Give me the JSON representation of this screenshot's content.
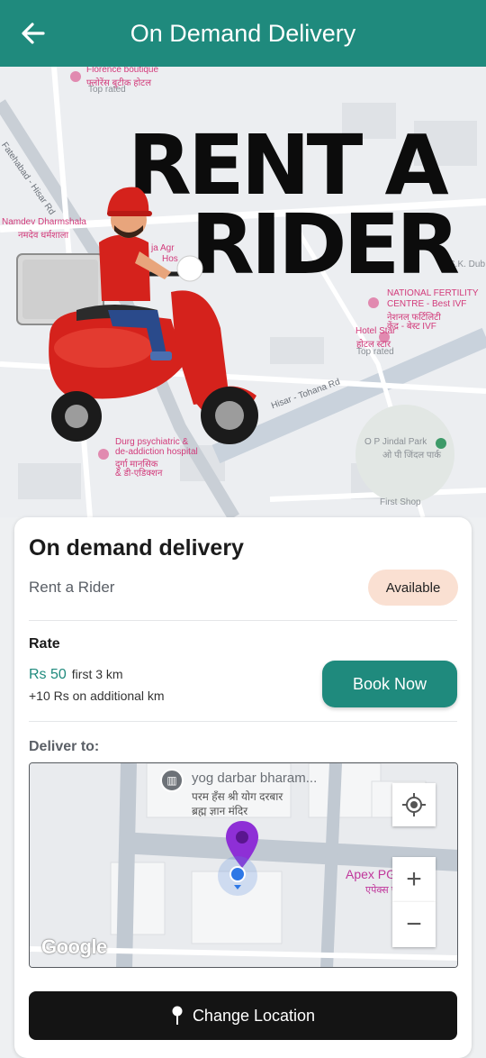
{
  "header": {
    "title": "On Demand Delivery",
    "back_icon": "back-arrow-icon"
  },
  "hero": {
    "title_line1": "RENT A",
    "title_line2": "RIDER",
    "map_labels": {
      "florence": "Florence boutique",
      "florence_hi": "फ्लोरेंस बुटीक होटल",
      "florence_top": "Top rated",
      "fatehabad_rd": "Fatehabad - Hisar Rd",
      "namdev": "Namdev Dharmshala",
      "namdev_hi": "नमदेव धर्मशाला",
      "agr": "ja Agr",
      "hos": "Hos",
      "sk": "S.K. Dub",
      "fertility": "NATIONAL FERTILITY",
      "fertility2": "CENTRE - Best IVF",
      "fertility_hi": "नेशनल फर्टिलिटी",
      "fertility_hi2": "केंद्र - बेस्ट IVF",
      "hotel_star": "Hotel Star",
      "hotel_star_hi": "होटल स्टार",
      "hotel_star_top": "Top rated",
      "tohana_rd": "Hisar - Tohana Rd",
      "jindal": "O P Jindal Park",
      "jindal_hi": "ओ पी जिंदल पार्क",
      "durga": "Durg psychiatric &",
      "durga2": "de-addiction hospital",
      "durga_hi": "दुर्गा मानसिक",
      "durga_hi2": "& डी-एडिक्शन",
      "first_shop": "First Shop"
    }
  },
  "card": {
    "title": "On demand delivery",
    "subtitle": "Rent a Rider",
    "status_badge": "Available",
    "rate_label": "Rate",
    "price": "Rs 50",
    "price_note": "first 3 km",
    "extra_rate": "+10 Rs on additional km",
    "book_button": "Book Now",
    "deliver_label": "Deliver to:",
    "map": {
      "poi_name": "yog darbar bharam...",
      "poi_hi1": "परम हँस श्री योग दरबार",
      "poi_hi2": "ब्रह्म ज्ञान मंदिर",
      "apex": "Apex PG Hisar",
      "apex_hi": "एपेक्स पीजी हिसार",
      "zoom_in": "+",
      "zoom_out": "−",
      "attribution": "Google"
    },
    "change_location_button": "Change Location"
  },
  "colors": {
    "primary": "#1f8a7d",
    "badge_bg": "#fae0d2",
    "dark_button": "#141414",
    "pin": "#8e2fd6"
  }
}
